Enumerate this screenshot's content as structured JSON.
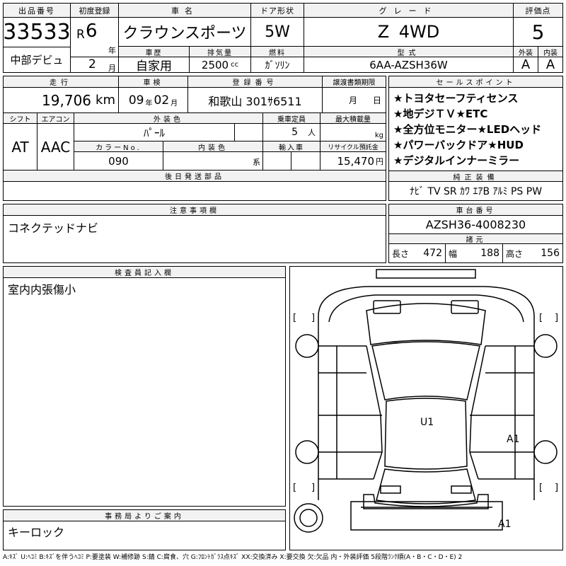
{
  "top": {
    "h_lot": "出品番号",
    "lot_no": "33533",
    "debut": "中部デビュ",
    "h_first_reg": "初度登録",
    "era": "R",
    "year": "6",
    "year_unit": "年",
    "month": "2",
    "month_unit": "月",
    "h_car_name": "車名",
    "car_name": "クラウンスポーツ",
    "h_door": "ドア形状",
    "door": "5W",
    "h_grade": "グレード",
    "grade": "Z 4WD",
    "h_score": "評価点",
    "score": "5",
    "h_history": "車歴",
    "history": "自家用",
    "h_displacement": "排気量",
    "displacement": "2500",
    "displacement_unit": "cc",
    "h_fuel": "燃料",
    "fuel": "ｶﾞｿﾘﾝ",
    "h_model": "型式",
    "model": "6AA-AZSH36W",
    "h_exterior": "外装",
    "exterior": "A",
    "h_interior": "内装",
    "interior": "A"
  },
  "second": {
    "h_mileage": "走行",
    "mileage": "19,706",
    "mileage_unit": "km",
    "h_inspection": "車検",
    "insp_year": "09",
    "insp_year_unit": "年",
    "insp_month": "02",
    "insp_month_unit": "月",
    "h_plate": "登録番号",
    "plate": "和歌山 301ｻ6511",
    "h_transfer": "譲渡書類期限",
    "transfer_month_unit": "月",
    "transfer_day_unit": "日",
    "h_shift": "シフト",
    "shift": "AT",
    "h_ac": "エアコン",
    "ac": "AAC",
    "h_color": "外装色",
    "color": "ﾊﾟｰﾙ",
    "h_capacity": "乗車定員",
    "capacity": "5",
    "capacity_unit": "人",
    "h_load": "最大積載量",
    "load_unit": "kg",
    "h_color_no": "カラーNo.",
    "color_no": "090",
    "h_int_color": "内装色",
    "int_color_unit": "系",
    "h_import": "輸入車",
    "h_recycle": "リサイクル預託金",
    "recycle": "15,470",
    "recycle_unit": "円",
    "h_later": "後日発送部品"
  },
  "selling_points": {
    "header": "セールスポイント",
    "items": [
      "★トヨタセーフティセンス",
      "★地デジＴＶ★ETC",
      "★全方位モニター★LEDヘッド",
      "★パワーバックドア★HUD",
      "★デジタルインナーミラー"
    ]
  },
  "equipment": {
    "header": "純正装備",
    "value": "ﾅﾋﾞ TV SR ｶﾜ ｴｱB ｱﾙﾐ PS PW"
  },
  "notes": {
    "header": "注意事項欄",
    "value": "コネクテッドナビ"
  },
  "chassis": {
    "header": "車台番号",
    "value": "AZSH36-4008230"
  },
  "dims": {
    "header": "諸元",
    "length_label": "長さ",
    "length": "472",
    "width_label": "幅",
    "width": "188",
    "height_label": "高さ",
    "height": "156"
  },
  "inspector": {
    "header": "検査員記入欄",
    "value": "室内内張傷小"
  },
  "office": {
    "header": "事務局よりご案内",
    "value": "キーロック"
  },
  "diagram": {
    "marks": [
      "U1",
      "A1",
      "A1"
    ],
    "brackets": [
      "[",
      "]",
      "[",
      "]",
      "[",
      "]",
      "[",
      "]"
    ]
  },
  "legend": "A:ｷｽﾞ U:ﾍｺﾐ B:ｷｽﾞを伴うﾍｺﾐ P:要塗装 W:補修跡 S:錆 C:腐食、穴 G:ﾌﾛﾝﾄｶﾞﾗｽ点ｷｽﾞ XX:交換済み X:要交換 欠:欠品 内・外装評価 5段階ﾗﾝｸ順(A・B・C・D・E) 2"
}
